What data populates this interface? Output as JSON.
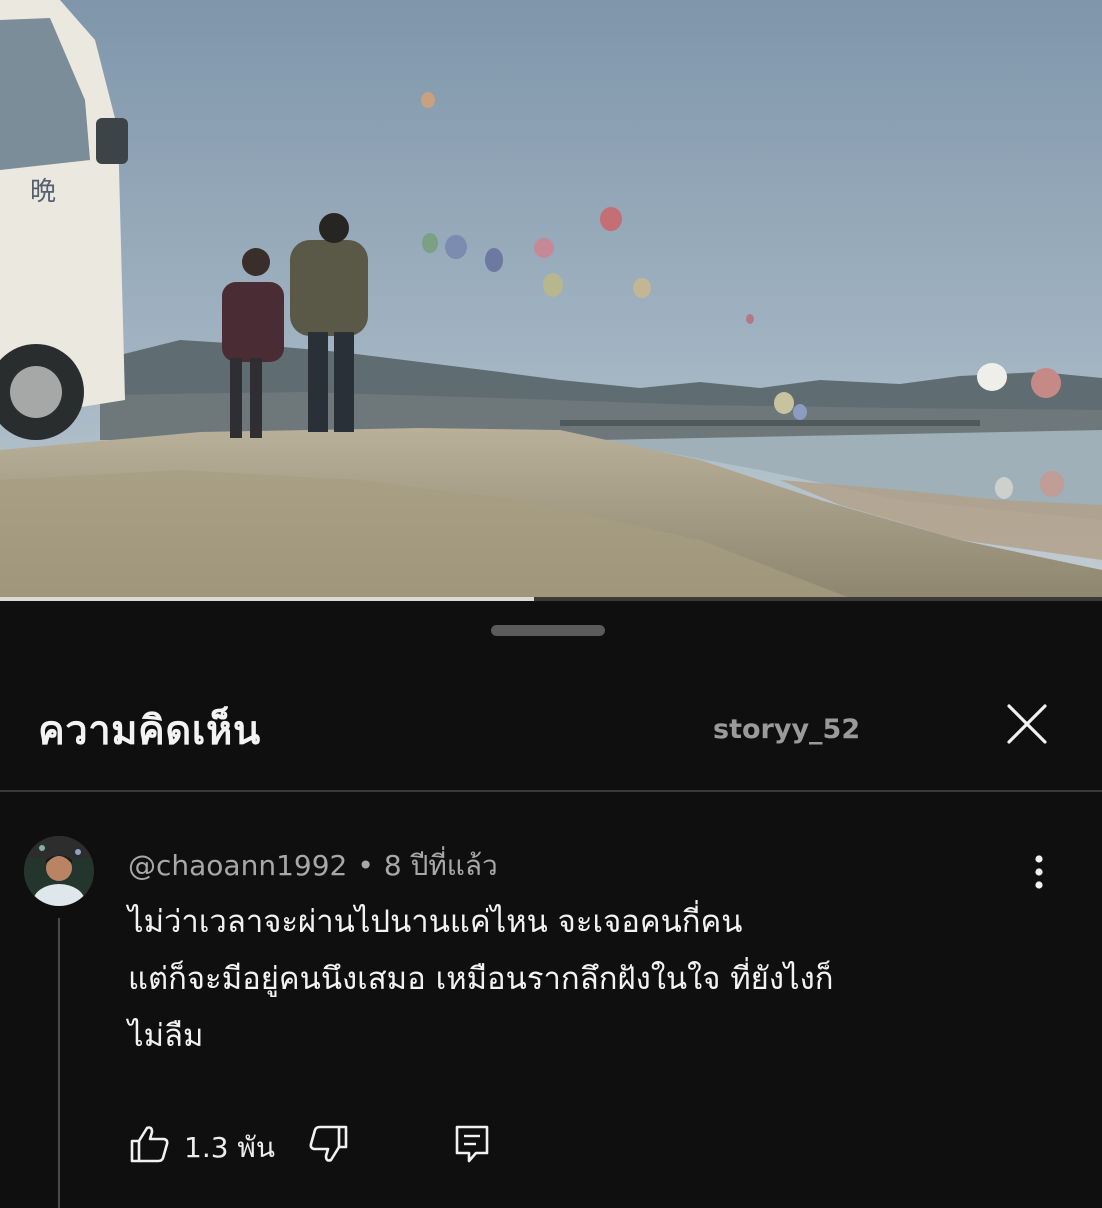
{
  "video": {
    "progress_fraction": 0.485
  },
  "sheet": {
    "title": "ความคิดเห็น",
    "watermark": "storyy_52",
    "close_icon": "close-icon"
  },
  "comment": {
    "author": "@chaoann1992",
    "separator": "•",
    "time": "8 ปีที่แล้ว",
    "lines": [
      "ไม่ว่าเวลาจะผ่านไปนานแค่ไหน จะเจอคนกี่คน",
      "แต่ก็จะมีอยู่คนนึงเสมอ เหมือนรากลึกฝังในใจ ที่ยังไงก็",
      "ไม่ลืม"
    ],
    "like_count": "1.3 พัน",
    "icons": {
      "like": "thumbs-up-icon",
      "dislike": "thumbs-down-icon",
      "reply": "reply-icon",
      "more": "more-vertical-icon"
    }
  },
  "colors": {
    "background": "#0f0f0f",
    "text": "#f1f1f1",
    "secondary_text": "#a8a8a8"
  }
}
